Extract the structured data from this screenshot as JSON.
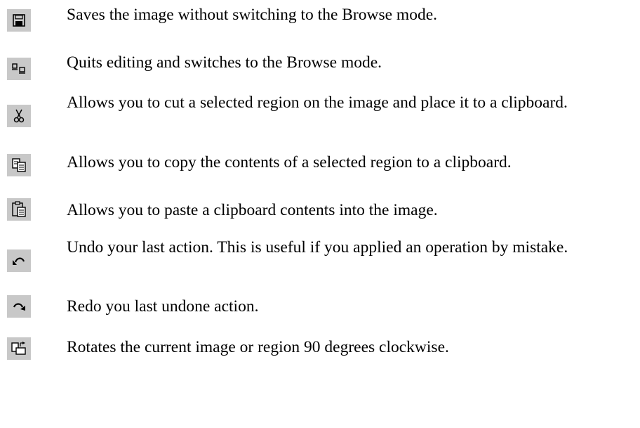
{
  "items": [
    {
      "icon": "save-icon",
      "text": "Saves the image without switching to the Browse mode."
    },
    {
      "icon": "browse-mode-icon",
      "text": "Quits editing and switches to the Browse mode."
    },
    {
      "icon": "cut-icon",
      "text": "Allows you to cut a selected region on the image and place it to a clipboard."
    },
    {
      "icon": "copy-icon",
      "text": "Allows you to copy the contents of a selected region to a  clipboard."
    },
    {
      "icon": "paste-icon",
      "text": "Allows you to paste a clipboard contents into the image."
    },
    {
      "icon": "undo-icon",
      "text": "Undo your last action. This is useful if you applied an operation by mistake."
    },
    {
      "icon": "redo-icon",
      "text": "Redo you last undone action."
    },
    {
      "icon": "rotate-icon",
      "text": "Rotates the current image or region 90 degrees clockwise."
    }
  ]
}
